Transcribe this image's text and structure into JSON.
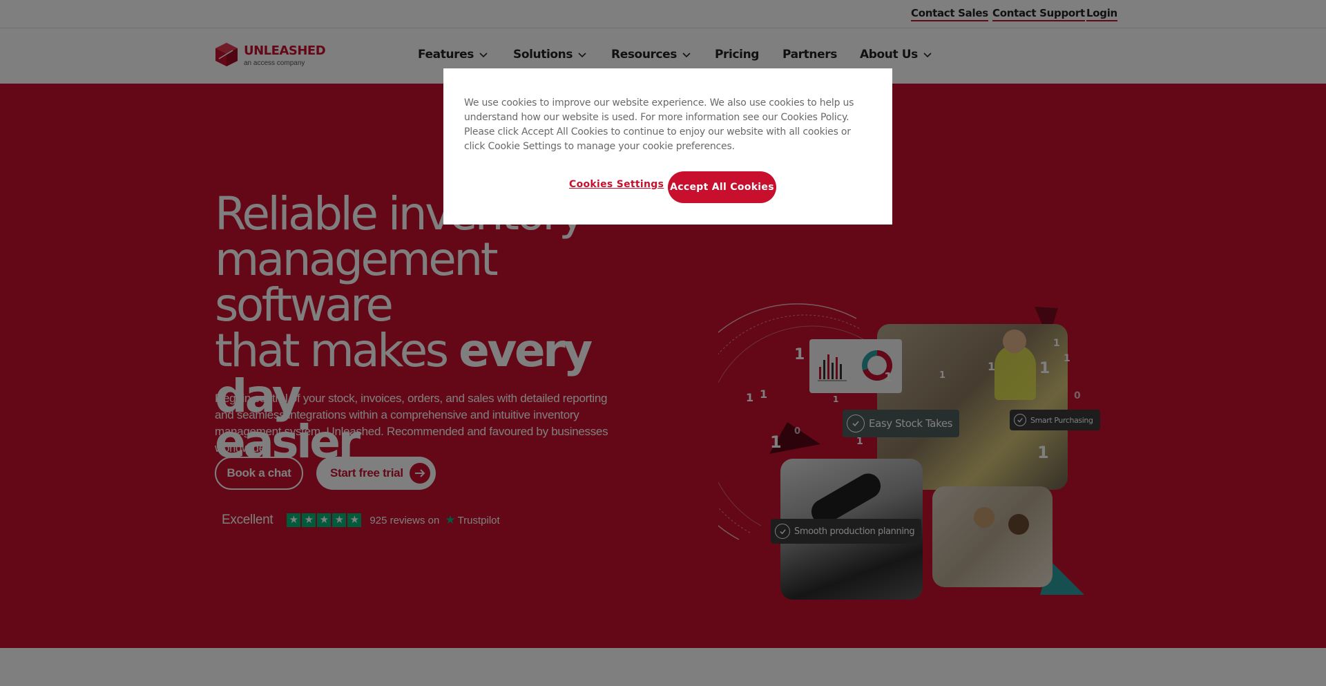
{
  "utility_nav": [
    "Contact Sales",
    "Contact Support",
    "Login"
  ],
  "brand": {
    "name": "UNLEASHED",
    "tagline": "an access company"
  },
  "nav": [
    {
      "label": "Features",
      "dropdown": true
    },
    {
      "label": "Solutions",
      "dropdown": true
    },
    {
      "label": "Resources",
      "dropdown": true
    },
    {
      "label": "Pricing",
      "dropdown": false
    },
    {
      "label": "Partners",
      "dropdown": false
    },
    {
      "label": "About Us",
      "dropdown": true
    }
  ],
  "hero": {
    "title_line1": "Reliable inventory",
    "title_line2": "management software",
    "title_line3_regular": "that makes ",
    "title_line3_bold": "every day",
    "title_line4_bold": "easier",
    "description": "Regain control of your stock, invoices, orders, and sales with detailed reporting and seamless integrations within a comprehensive and intuitive inventory management system, Unleashed. Recommended and favoured by businesses worldwide.",
    "cta_secondary": "Book a chat",
    "cta_primary": "Start free trial"
  },
  "trustpilot": {
    "rating_text": "Excellent",
    "stars": 5,
    "reviews_text": "925 reviews on",
    "brand": "Trustpilot"
  },
  "illustration_tags": {
    "stock_takes": "Easy Stock Takes",
    "smart_purchasing": "Smart Purchasing",
    "production": "Smooth production planning"
  },
  "cookie_banner": {
    "message": "We use cookies to improve our website experience. We also use cookies to help us understand how our website is used. For more information see our Cookies Policy. Please click Accept All Cookies to continue to enjoy our website with all cookies or click Cookie Settings to manage your cookie preferences.",
    "settings_label": "Cookies Settings",
    "accept_label": "Accept All Cookies"
  },
  "colors": {
    "brand_red": "#c8102e",
    "trustpilot_green": "#00b67a",
    "overlay": "rgba(0,0,0,0.5)"
  }
}
